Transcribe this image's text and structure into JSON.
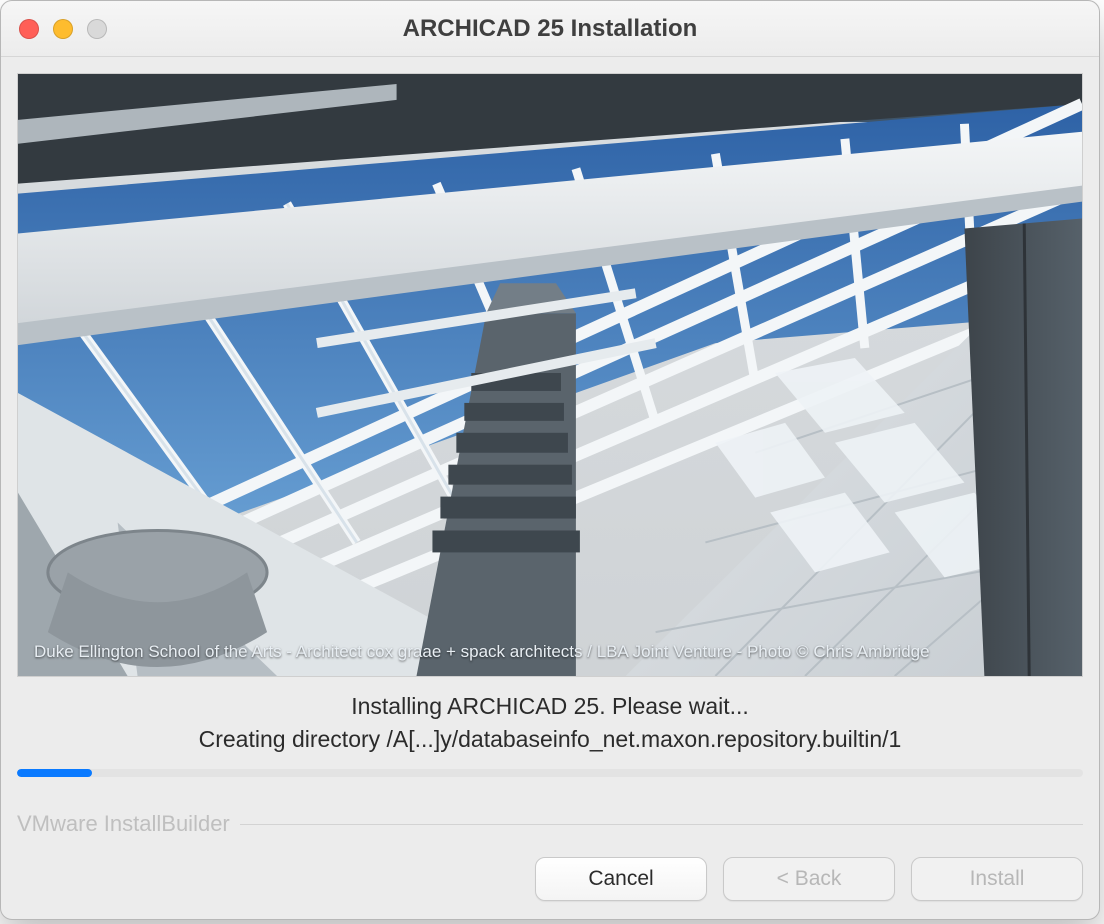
{
  "titlebar": {
    "title": "ARCHICAD 25 Installation"
  },
  "hero": {
    "caption": "Duke Ellington School of the Arts - Architect cox graae + spack architects /  LBA Joint Venture - Photo © Chris Ambridge"
  },
  "status": {
    "main": "Installing ARCHICAD 25. Please wait...",
    "sub": "Creating directory /A[...]y/databaseinfo_net.maxon.repository.builtin/1"
  },
  "progress": {
    "percent": 7
  },
  "footer": {
    "builder": "VMware InstallBuilder"
  },
  "buttons": {
    "cancel": "Cancel",
    "back": "< Back",
    "install": "Install"
  }
}
